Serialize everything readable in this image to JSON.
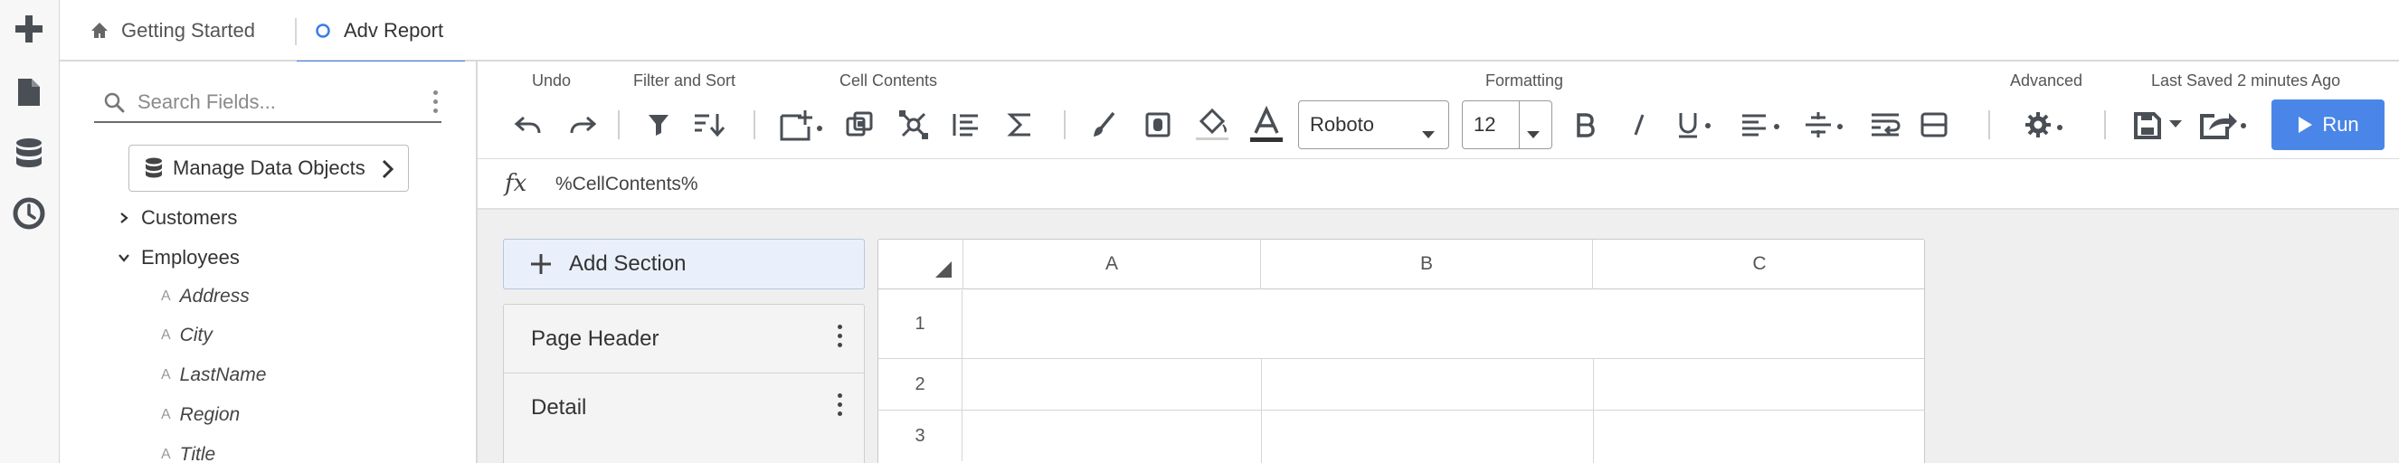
{
  "rail": {
    "icons": [
      "plus-icon",
      "document-icon",
      "database-icon",
      "clock-icon"
    ]
  },
  "tabs": [
    {
      "label": "Getting Started",
      "icon": "home-icon",
      "active": false
    },
    {
      "label": "Adv Report",
      "icon": "circle-icon",
      "active": true
    }
  ],
  "fields": {
    "search_placeholder": "Search Fields...",
    "manage_label": "Manage Data Objects",
    "tree": [
      {
        "label": "Customers",
        "expanded": false
      },
      {
        "label": "Employees",
        "expanded": true
      }
    ],
    "leaves": [
      "Address",
      "City",
      "LastName",
      "Region",
      "Title"
    ],
    "leaf_type_glyph": "A"
  },
  "toolbar": {
    "groups": {
      "undo": "Undo",
      "filter_sort": "Filter and Sort",
      "cell_contents": "Cell Contents",
      "formatting": "Formatting",
      "advanced": "Advanced"
    },
    "last_saved": "Last Saved 2 minutes Ago",
    "font": "Roboto",
    "font_size": "12",
    "run_label": "Run",
    "accent": "#4a86e8"
  },
  "formula": {
    "fx": "fx",
    "text": "%CellContents%"
  },
  "canvas": {
    "add_section_label": "Add Section",
    "sections": [
      "Page Header",
      "Detail"
    ],
    "columns": [
      "A",
      "B",
      "C"
    ],
    "rows": [
      "1",
      "2",
      "3"
    ]
  }
}
